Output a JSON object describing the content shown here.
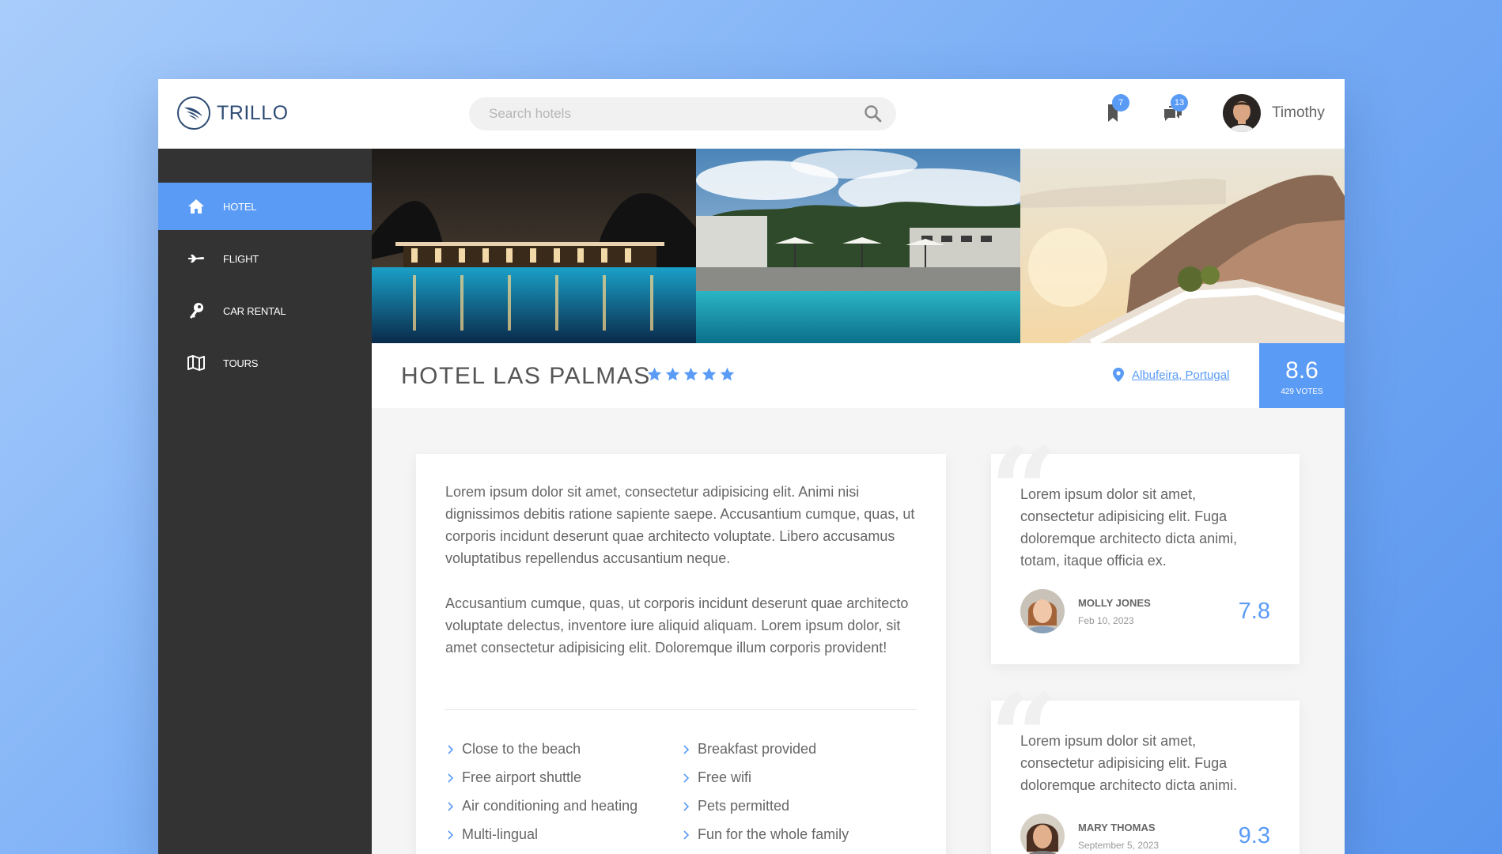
{
  "brand": {
    "name": "TRILLO"
  },
  "search": {
    "placeholder": "Search hotels"
  },
  "header": {
    "bookmarks_count": "7",
    "messages_count": "13",
    "user_name": "Timothy"
  },
  "sidebar": {
    "items": [
      {
        "label": "Hotel",
        "icon": "home-icon",
        "active": true
      },
      {
        "label": "Flight",
        "icon": "airplane-icon",
        "active": false
      },
      {
        "label": "Car rental",
        "icon": "key-icon",
        "active": false
      },
      {
        "label": "Tours",
        "icon": "map-icon",
        "active": false
      }
    ]
  },
  "gallery": {
    "photos": [
      "hotel-night-pool-photo",
      "hotel-day-pool-photo",
      "hotel-cliff-terrace-photo"
    ]
  },
  "hotel": {
    "name": "Hotel Las Palmas",
    "stars": 5,
    "location": "Albufeira, Portugal",
    "rating": "8.6",
    "votes": "429 votes"
  },
  "description": {
    "paragraphs": [
      "Lorem ipsum dolor sit amet, consectetur adipisicing elit. Animi nisi dignissimos debitis ratione sapiente saepe. Accusantium cumque, quas, ut corporis incidunt deserunt quae architecto voluptate. Libero accusamus voluptatibus repellendus accusantium neque.",
      "Accusantium cumque, quas, ut corporis incidunt deserunt quae architecto voluptate delectus, inventore iure aliquid aliquam. Lorem ipsum dolor, sit amet consectetur adipisicing elit. Doloremque illum corporis provident!"
    ],
    "features": [
      "Close to the beach",
      "Breakfast provided",
      "Free airport shuttle",
      "Free wifi",
      "Air conditioning and heating",
      "Pets permitted",
      "Multi-lingual",
      "Fun for the whole family"
    ]
  },
  "reviews": [
    {
      "text": "Lorem ipsum dolor sit amet, consectetur adipisicing elit. Fuga doloremque architecto dicta animi, totam, itaque officia ex.",
      "name": "Molly Jones",
      "date": "Feb 10, 2023",
      "rating": "7.8"
    },
    {
      "text": "Lorem ipsum dolor sit amet, consectetur adipisicing elit. Fuga doloremque architecto dicta animi.",
      "name": "Mary Thomas",
      "date": "September 5, 2023",
      "rating": "9.3"
    }
  ],
  "colors": {
    "accent": "#5a9bf6",
    "sidebar": "#333333",
    "brand": "#2e4c74"
  }
}
